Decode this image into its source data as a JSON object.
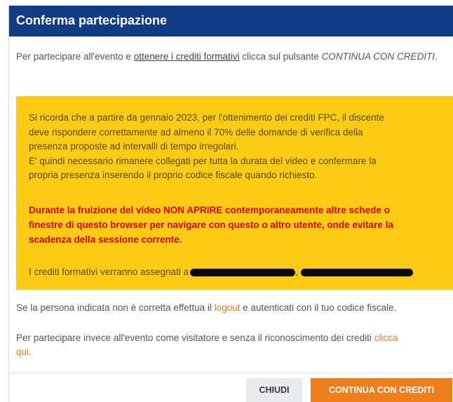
{
  "dialog": {
    "title": "Conferma partecipazione",
    "intro": {
      "part1": "Per partecipare all'evento e ",
      "link": "ottenere i crediti formativi",
      "part2": " clicca sul pulsante ",
      "button_ref": "CONTINUA CON CREDITI",
      "part3": "."
    },
    "notice": {
      "line1": "Si ricorda che a partire da gennaio 2023, per l'ottenimento dei crediti FPC, il discente",
      "line2": "deve rispondere correttamente ad almeno il 70% delle domande di verifica della",
      "line3": "presenza proposte ad intervalli di tempo irregolari.",
      "line4": "E' quindi necessario rimanere collegati per tutta la durata del video e confermare la",
      "line5": "propria presenza inserendo il proprio codice fiscale quando richiesto.",
      "warning_line1": "Durante la fruizione del video NON APRIRE contemporaneamente altre schede o",
      "warning_line2": "finestre di questo browser per navigare con questo o altro utente, onde evitare la",
      "warning_line3": "scadenza della sessione corrente.",
      "credits_prefix": "I crediti formativi verranno assegnati a",
      "credits_separator": ","
    },
    "wrong_person": {
      "part1": "Se la persona indicata non è corretta effettua il ",
      "link": "logout",
      "part2": " e autenticati con il tuo codice fiscale."
    },
    "visitor": {
      "line1_text": "Per partecipare invece all'evento come visitatore e senza il riconoscimento dei crediti ",
      "line1_link": "clicca",
      "line2_link": "qui",
      "line2_text": "."
    },
    "buttons": {
      "close": "CHIUDI",
      "continue": "CONTINUA CON CREDITI"
    }
  },
  "colors": {
    "header": "#113b82",
    "notice_bg": "#fccb14",
    "warning": "#e3001b",
    "link": "#e67a1f",
    "primary_button": "#ee7d1e"
  }
}
